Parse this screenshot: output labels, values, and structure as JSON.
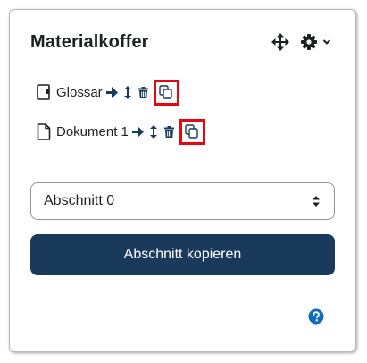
{
  "block": {
    "title": "Materialkoffer"
  },
  "activities": [
    {
      "label": "Glossar",
      "icon": "glossary-icon"
    },
    {
      "label": "Dokument 1",
      "icon": "document-icon"
    }
  ],
  "section_select": {
    "value": "Abschnitt 0"
  },
  "copy_button": {
    "label": "Abschnitt kopieren"
  },
  "colors": {
    "primary": "#1a3a5c",
    "highlight": "#e40612",
    "text": "#1d2125",
    "help_icon": "#0f6cbf"
  }
}
